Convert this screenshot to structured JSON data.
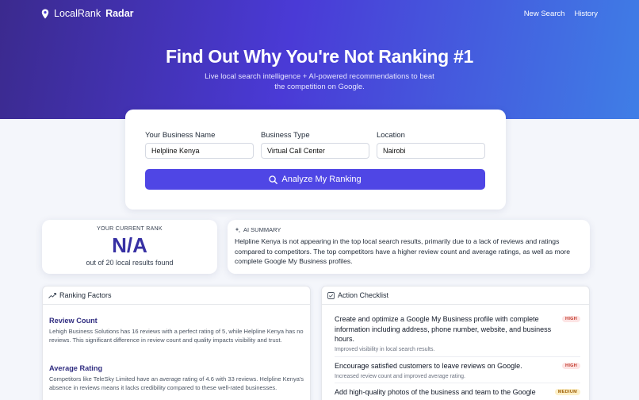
{
  "nav": {
    "brand_light": "LocalRank",
    "brand_bold": "Radar",
    "links": [
      "New Search",
      "History"
    ]
  },
  "hero": {
    "title": "Find Out Why You're Not Ranking #1",
    "subtitle": "Live local search intelligence + AI-powered recommendations to beat the competition on Google."
  },
  "form": {
    "business_name_label": "Your Business Name",
    "business_name_value": "Helpline Kenya",
    "business_type_label": "Business Type",
    "business_type_value": "Virtual Call Center",
    "location_label": "Location",
    "location_value": "Nairobi",
    "analyze_label": "Analyze My Ranking"
  },
  "rank": {
    "label": "YOUR CURRENT RANK",
    "value": "N/A",
    "sub": "out of 20 local results found"
  },
  "summary": {
    "label": "AI SUMMARY",
    "text": "Helpline Kenya is not appearing in the top local search results, primarily due to a lack of reviews and ratings compared to competitors. The top competitors have a higher review count and average ratings, as well as more complete Google My Business profiles."
  },
  "factors": {
    "header": "Ranking Factors",
    "items": [
      {
        "title": "Review Count",
        "desc": "Lehigh Business Solutions has 16 reviews with a perfect rating of 5, while Helpline Kenya has no reviews. This significant difference in review count and quality impacts visibility and trust."
      },
      {
        "title": "Average Rating",
        "desc": "Competitors like TeleSky Limited have an average rating of 4.6 with 33 reviews. Helpline Kenya's absence in reviews means it lacks credibility compared to these well-rated businesses."
      }
    ]
  },
  "checklist": {
    "header": "Action Checklist",
    "items": [
      {
        "title": "Create and optimize a Google My Business profile with complete information including address, phone number, website, and business hours.",
        "sub": "Improved visibility in local search results.",
        "priority": "HIGH"
      },
      {
        "title": "Encourage satisfied customers to leave reviews on Google.",
        "sub": "Increased review count and improved average rating.",
        "priority": "HIGH"
      },
      {
        "title": "Add high-quality photos of the business and team to the Google",
        "sub": "",
        "priority": "MEDIUM"
      }
    ]
  },
  "colors": {
    "accent": "#4f46e5",
    "rank_value": "#3730a3",
    "high_badge": "#c0392b",
    "medium_badge": "#a16207"
  }
}
